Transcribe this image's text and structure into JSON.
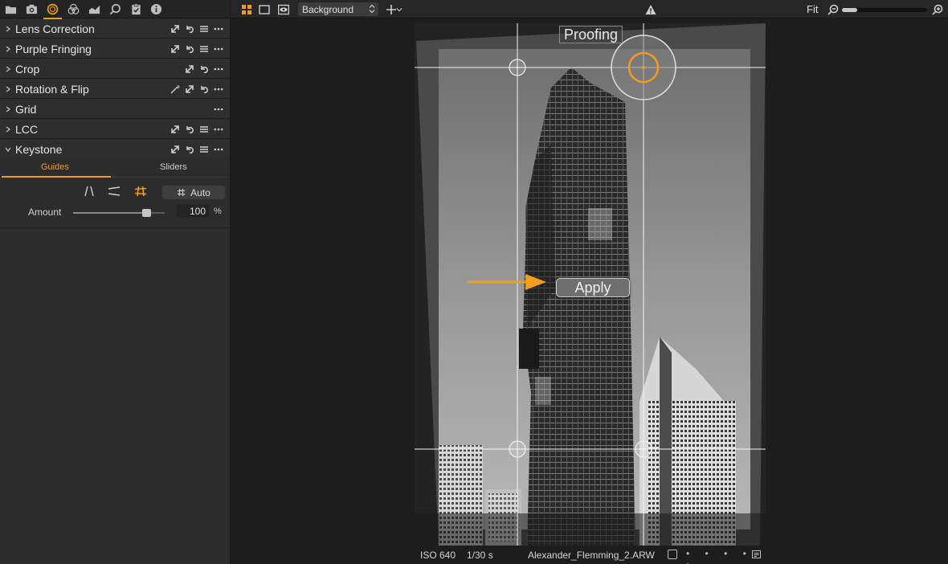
{
  "tool_tabs": [
    {
      "icon": "folder-icon",
      "active": false
    },
    {
      "icon": "camera-icon",
      "active": false
    },
    {
      "icon": "lens-icon",
      "active": true
    },
    {
      "icon": "color-circles-icon",
      "active": false
    },
    {
      "icon": "exposure-icon",
      "active": false
    },
    {
      "icon": "details-search-icon",
      "active": false
    },
    {
      "icon": "clipboard-check-icon",
      "active": false
    },
    {
      "icon": "info-icon",
      "active": false
    }
  ],
  "tools": [
    {
      "label": "Lens Correction",
      "expanded": false
    },
    {
      "label": "Purple Fringing",
      "expanded": false
    },
    {
      "label": "Crop",
      "expanded": false
    },
    {
      "label": "Rotation & Flip",
      "expanded": false
    },
    {
      "label": "Grid",
      "expanded": false
    },
    {
      "label": "LCC",
      "expanded": false
    },
    {
      "label": "Keystone",
      "expanded": true
    }
  ],
  "keystone": {
    "tabs": {
      "guides": "Guides",
      "sliders": "Sliders"
    },
    "active_tab": "Guides",
    "auto_label": "Auto",
    "amount_label": "Amount",
    "amount_value": "100",
    "amount_unit": "%",
    "amount_fraction": 0.8
  },
  "toolbar": {
    "style_select": "Background",
    "fit_label": "Fit",
    "zoom_fraction": 0.18
  },
  "viewer": {
    "proofing_label": "Proofing",
    "apply_label": "Apply",
    "status": {
      "iso": "ISO 640",
      "shutter": "1/30 s",
      "filename": "Alexander_Flemming_2.ARW",
      "rating_dots": "• • • • •"
    }
  },
  "colors": {
    "accent": "#f39c1e",
    "panel_bg": "#2c2c2c",
    "viewer_bg": "#1d1d1d"
  }
}
